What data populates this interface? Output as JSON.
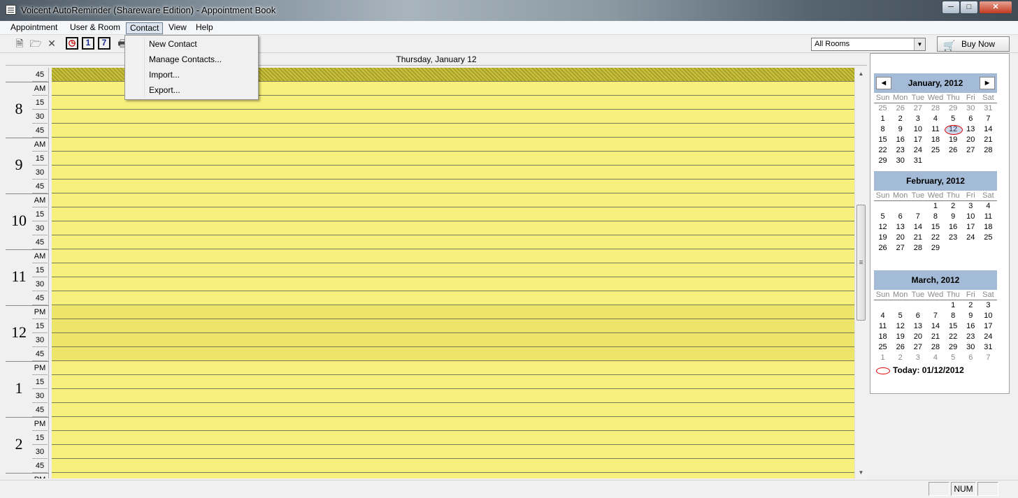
{
  "window": {
    "title": "Voicent AutoReminder (Shareware Edition) - Appointment Book"
  },
  "menubar": {
    "items": [
      "Appointment",
      "User & Room",
      "Contact",
      "View",
      "Help"
    ]
  },
  "contact_menu": {
    "items": [
      "New Contact",
      "Manage Contacts...",
      "Import...",
      "Export..."
    ]
  },
  "toolbar": {
    "rooms_select": "All Rooms",
    "buy_now": "Buy Now",
    "icon_one": "1",
    "icon_seven": "7"
  },
  "schedule": {
    "day_label": "Thursday, January 12",
    "hours": [
      {
        "hour": "8",
        "ampm": "AM"
      },
      {
        "hour": "9",
        "ampm": "AM"
      },
      {
        "hour": "10",
        "ampm": "AM"
      },
      {
        "hour": "11",
        "ampm": "AM"
      },
      {
        "hour": "12",
        "ampm": "PM"
      },
      {
        "hour": "1",
        "ampm": "PM"
      },
      {
        "hour": "2",
        "ampm": "PM"
      }
    ],
    "first_tick": "45",
    "last_ampm": "PM",
    "quarters": [
      "15",
      "30",
      "45"
    ]
  },
  "calendar": {
    "dow": [
      "Sun",
      "Mon",
      "Tue",
      "Wed",
      "Thu",
      "Fri",
      "Sat"
    ],
    "months": [
      {
        "title": "January, 2012",
        "weeks": [
          [
            "25",
            "26",
            "27",
            "28",
            "29",
            "30",
            "31"
          ],
          [
            "1",
            "2",
            "3",
            "4",
            "5",
            "6",
            "7"
          ],
          [
            "8",
            "9",
            "10",
            "11",
            "12",
            "13",
            "14"
          ],
          [
            "15",
            "16",
            "17",
            "18",
            "19",
            "20",
            "21"
          ],
          [
            "22",
            "23",
            "24",
            "25",
            "26",
            "27",
            "28"
          ],
          [
            "29",
            "30",
            "31",
            "",
            "",
            "",
            ""
          ]
        ]
      },
      {
        "title": "February, 2012",
        "weeks": [
          [
            "",
            "",
            "",
            "1",
            "2",
            "3",
            "4"
          ],
          [
            "5",
            "6",
            "7",
            "8",
            "9",
            "10",
            "11"
          ],
          [
            "12",
            "13",
            "14",
            "15",
            "16",
            "17",
            "18"
          ],
          [
            "19",
            "20",
            "21",
            "22",
            "23",
            "24",
            "25"
          ],
          [
            "26",
            "27",
            "28",
            "29",
            "",
            "",
            ""
          ]
        ]
      },
      {
        "title": "March, 2012",
        "weeks": [
          [
            "",
            "",
            "",
            "",
            "1",
            "2",
            "3"
          ],
          [
            "4",
            "5",
            "6",
            "7",
            "8",
            "9",
            "10"
          ],
          [
            "11",
            "12",
            "13",
            "14",
            "15",
            "16",
            "17"
          ],
          [
            "18",
            "19",
            "20",
            "21",
            "22",
            "23",
            "24"
          ],
          [
            "25",
            "26",
            "27",
            "28",
            "29",
            "30",
            "31"
          ],
          [
            "1",
            "2",
            "3",
            "4",
            "5",
            "6",
            "7"
          ]
        ]
      }
    ],
    "today_label": "Today: 01/12/2012"
  },
  "statusbar": {
    "num": "NUM"
  }
}
